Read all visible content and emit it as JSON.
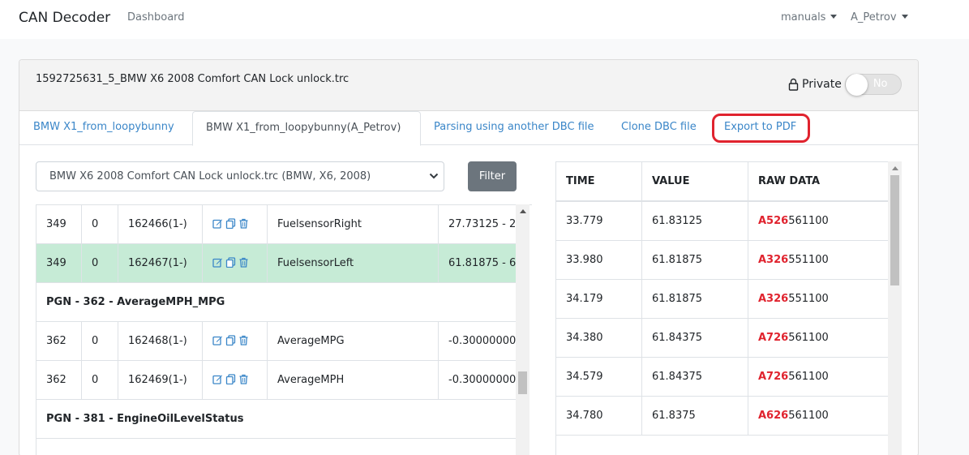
{
  "navbar": {
    "brand": "CAN Decoder",
    "dashboard": "Dashboard",
    "manuals": "manuals",
    "user": "A_Petrov"
  },
  "card": {
    "file_title": "1592725631_5_BMW X6 2008 Comfort CAN Lock unlock.trc",
    "private_label": "Private",
    "private_toggle": "No"
  },
  "tabs": [
    {
      "label": "BMW X1_from_loopybunny"
    },
    {
      "label": "BMW X1_from_loopybunny(A_Petrov)"
    },
    {
      "label": "Parsing using another DBC file"
    },
    {
      "label": "Clone DBC file"
    },
    {
      "label": "Export to PDF"
    }
  ],
  "select": {
    "value": "BMW X6 2008 Comfort CAN Lock unlock.trc (BMW, X6, 2008)"
  },
  "filter_label": "Filter",
  "left_rows": [
    {
      "type": "row",
      "id": "349",
      "bus": "0",
      "sig": "162466(1-)",
      "name": "FuelsensorRight",
      "range": "27.73125 - 2",
      "highlight": false
    },
    {
      "type": "row",
      "id": "349",
      "bus": "0",
      "sig": "162467(1-)",
      "name": "FuelsensorLeft",
      "range": "61.81875 - 6",
      "highlight": true
    },
    {
      "type": "pgn",
      "label": "PGN - 362 - AverageMPH_MPG"
    },
    {
      "type": "row",
      "id": "362",
      "bus": "0",
      "sig": "162468(1-)",
      "name": "AverageMPG",
      "range": "-0.30000000",
      "highlight": false
    },
    {
      "type": "row",
      "id": "362",
      "bus": "0",
      "sig": "162469(1-)",
      "name": "AverageMPH",
      "range": "-0.30000000",
      "highlight": false
    },
    {
      "type": "pgn",
      "label": "PGN - 381 - EngineOilLevelStatus"
    }
  ],
  "right_table": {
    "headers": [
      "TIME",
      "VALUE",
      "RAW DATA"
    ],
    "rows": [
      {
        "time": "33.779",
        "value": "61.83125",
        "raw_hi": "A526",
        "raw_rest": "561100"
      },
      {
        "time": "33.980",
        "value": "61.81875",
        "raw_hi": "A326",
        "raw_rest": "551100"
      },
      {
        "time": "34.179",
        "value": "61.81875",
        "raw_hi": "A326",
        "raw_rest": "551100"
      },
      {
        "time": "34.380",
        "value": "61.84375",
        "raw_hi": "A726",
        "raw_rest": "561100"
      },
      {
        "time": "34.579",
        "value": "61.84375",
        "raw_hi": "A726",
        "raw_rest": "561100"
      },
      {
        "time": "34.780",
        "value": "61.8375",
        "raw_hi": "A626",
        "raw_rest": "561100"
      }
    ]
  },
  "colors": {
    "link": "#3a86c8",
    "highlight_row": "#c6ebd6",
    "raw_highlight": "#e0232e",
    "annotation": "#e0232e"
  }
}
